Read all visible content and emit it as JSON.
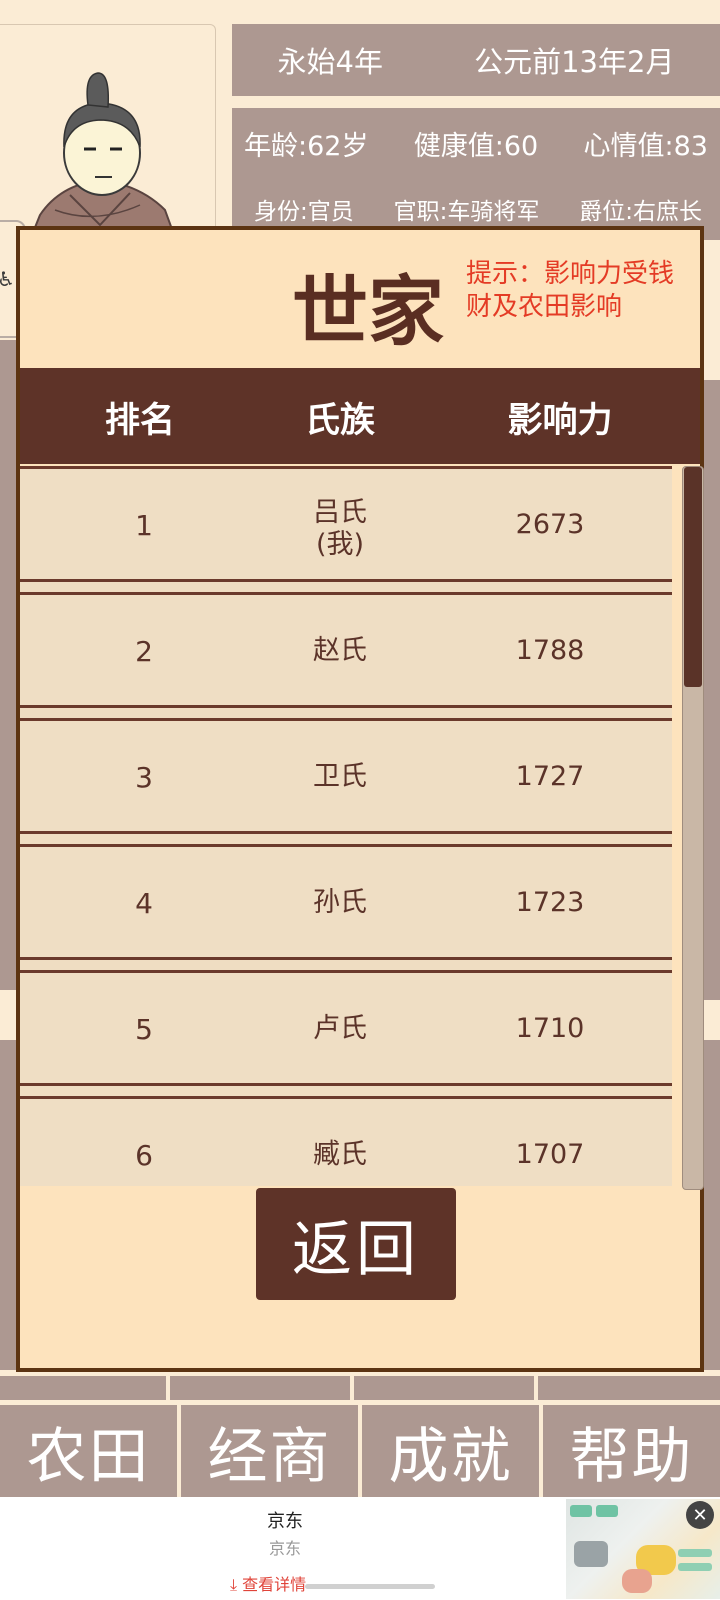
{
  "status": {
    "era": "永始4年",
    "date": "公元前13年2月",
    "age": "年龄:62岁",
    "health": "健康值:60",
    "mood": "心情值:83",
    "identity": "身份:官员",
    "office": "官职:车骑将军",
    "rank": "爵位:右庶长"
  },
  "modal": {
    "title": "世家",
    "hint": "提示：影响力受钱财及农田影响",
    "columns": [
      "排名",
      "氏族",
      "影响力"
    ],
    "rows": [
      {
        "rank": "1",
        "clan": "吕氏",
        "clan_note": "(我)",
        "influence": "2673"
      },
      {
        "rank": "2",
        "clan": "赵氏",
        "clan_note": "",
        "influence": "1788"
      },
      {
        "rank": "3",
        "clan": "卫氏",
        "clan_note": "",
        "influence": "1727"
      },
      {
        "rank": "4",
        "clan": "孙氏",
        "clan_note": "",
        "influence": "1723"
      },
      {
        "rank": "5",
        "clan": "卢氏",
        "clan_note": "",
        "influence": "1710"
      },
      {
        "rank": "6",
        "clan": "臧氏",
        "clan_note": "",
        "influence": "1707"
      }
    ],
    "back_label": "返回"
  },
  "nav": [
    "农田",
    "经商",
    "成就",
    "帮助"
  ],
  "ad": {
    "title": "京东",
    "subtitle": "京东",
    "link": "查看详情",
    "close": "✕"
  },
  "colors": {
    "accent_dark": "#5e3328",
    "panel_bg": "#fde3bd",
    "hint_red": "#e43b25",
    "stat_bar": "#ad9891"
  }
}
